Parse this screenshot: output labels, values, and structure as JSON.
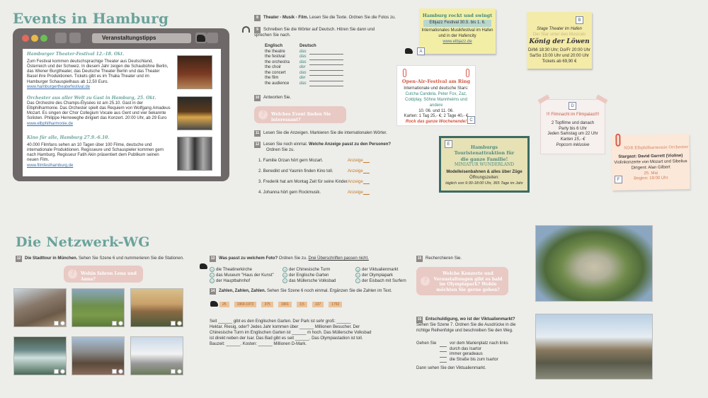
{
  "top": {
    "title": "Events in Hamburg",
    "window_title": "Veranstaltungstipps",
    "events": [
      {
        "heading": "Hamburger Theater-Festival 12.-18. Okt.",
        "text": "Zum Festival kommen deutschsprachige Theater aus Deutschland, Österreich und der Schweiz. In diesem Jahr zeigen die Schaubühne Berlin, das Wiener Burgtheater, das Deutsche Theater Berlin und das Theater Basel ihre Produktionen. Tickets gibt es im Thalia Theater und im Hamburger Schauspielhaus ab 12,50 Euro.",
        "link": "www.hamburgertheaterfestival.de"
      },
      {
        "heading": "Orchester aus aller Welt zu Gast in Hamburg, 25. Okt.",
        "text": "Das Orchestre des Champs-Élysées ist am 25.10. Gast in der Elbphilharmonie. Das Orchester spielt das Requiem von Wolfgang Amadeus Mozart. Es singen der Chor Collegium Vocale aus Gent und vier bekannte Solisten. Philippe Herreweghe dirigiert das Konzert. 20:00 Uhr, ab 29 Euro",
        "link": "www.elbphilharmonie.de"
      },
      {
        "heading": "Kino für alle, Hamburg 27.9.-6.10.",
        "text": "40.000 Filmfans sehen an 10 Tagen über 100 Filme, deutsche und internationale Produktionen. Regisseure und Schauspieler kommen gern nach Hamburg. Regisseur Fatih Akin präsentiert dem Publikum seinen neuen Film.",
        "link": "www.filmfesthamburg.de"
      }
    ],
    "t8": {
      "num": "8",
      "bold": "Theater - Musik - Film.",
      "text": " Lesen Sie die Texte. Ordnen Sie die Fotos zu."
    },
    "t9": {
      "num": "9",
      "text": "Schreiben Sie die Wörter auf Deutsch. Hören Sie dann und sprechen Sie nach.",
      "col1": "Englisch",
      "col2": "Deutsch",
      "rows": [
        {
          "en": "the theatre",
          "de": "das"
        },
        {
          "en": "the festival",
          "de": "das"
        },
        {
          "en": "the orchestra",
          "de": "das"
        },
        {
          "en": "the choir",
          "de": "der"
        },
        {
          "en": "the concert",
          "de": "das"
        },
        {
          "en": "the film",
          "de": "der"
        },
        {
          "en": "the audience",
          "de": "das"
        }
      ]
    },
    "t10": {
      "num": "10",
      "text": "Antworten Sie.",
      "bubble": "Welches Event finden Sie interessant?"
    },
    "t11": {
      "num": "11",
      "text": "Lesen Sie die Anzeigen. Markieren Sie die internationalen Wörter."
    },
    "t12": {
      "num": "12",
      "text": "Lesen Sie noch einmal. ",
      "bold": "Welche Anzeige passt zu den Personen?",
      "text2": "Ordnen Sie zu.",
      "items": [
        {
          "text": "1. Familie Orzan hört gern Mozart.",
          "label": "Anzeige"
        },
        {
          "text": "2. Benedikt und Yasmin finden Kino toll.",
          "label": "Anzeige"
        },
        {
          "text": "3. Frederik hat am Montag Zeit für seine Kinder.",
          "label": "Anzeige"
        },
        {
          "text": "4. Johanna hört gern Rockmusik.",
          "label": "Anzeige"
        }
      ]
    },
    "ads": {
      "A": {
        "letter": "A",
        "title": "Hamburg rockt und swingt",
        "sub": "Elbjazz Festival 30.5. bis 1. 6.",
        "text": "Internationales Musikfestival im Hafen und in der Hafencity",
        "link": "www.elbjazz.de"
      },
      "B": {
        "letter": "B",
        "l1": "Stage Theater im Hafen",
        "l2": "Der Star unter den Musicals",
        "title": "König der Löwen",
        "l3": "Di/Mi 18:30 Uhr; Do/Fr 20:00 Uhr",
        "l4": "Sa/So 15:00 Uhr und 20:00 Uhr",
        "l5": "Tickets ab 69,90 €"
      },
      "C": {
        "letter": "C",
        "title": "Open-Air-Festival am Ring",
        "l1": "Internationale und deutsche Stars:",
        "l2": "Culcha Candela, Peter Fox, Zaz, Coldplay, Söhne Mannheims und andere",
        "l3": "10. 06. und 11. 06.",
        "l4": "Karten: 1 Tag 25,- €; 2 Tage 40,- €",
        "l5": "Rock das ganze Wochenende!"
      },
      "D": {
        "letter": "D",
        "title": "!!! Filmnacht im Filmpalast!!!",
        "l1": "2 Topfilme und danach",
        "l2": "Party bis 6 Uhr",
        "l3": "Jeden Samstag um 22 Uhr",
        "l4": "Karten 15,- €",
        "l5": "Popcorn inklusive"
      },
      "E": {
        "letter": "E",
        "title": "Hamburgs Touristenattraktion für die ganze Familie!",
        "sub": "MINIATUR WUNDERLAND",
        "l1": "Modelleisenbahnen & alles über Züge",
        "l2": "Öffnungszeiten:",
        "l3": "täglich von 9:30-18:00 Uhr, 365 Tage im Jahr"
      },
      "F": {
        "letter": "F",
        "title": "NDR Elbphilharmonie Orchester",
        "l1": "Stargast: David Garrett (Violine)",
        "l2": "Violinkonzerte von Mozart und Sibelius",
        "l3": "Dirigent: Alan Gilbert",
        "l4": "25. Mai",
        "l5": "Beginn: 19:00 Uhr"
      }
    }
  },
  "bottom": {
    "title": "Die Netzwerk-WG",
    "t12": {
      "num": "12",
      "bold": "Die Stadttour in München.",
      "text": " Sehen Sie Szene 6 und nummerieren Sie die Stationen.",
      "bubble": "Wohin fahren Lena und Anna?"
    },
    "t13": {
      "num": "13",
      "bold": "Was passt zu welchem Foto?",
      "text": " Ordnen Sie zu. ",
      "under": "Drei Überschriften passen nicht.",
      "items": [
        {
          "letter": "a",
          "text": "die Theatinerkirche"
        },
        {
          "letter": "b",
          "text": "das Museum \"Haus der Kunst\""
        },
        {
          "letter": "c",
          "text": "der Hauptbahnhof"
        },
        {
          "letter": "d",
          "text": "der Chinesische Turm"
        },
        {
          "letter": "e",
          "text": "der Englische Garten"
        },
        {
          "letter": "f",
          "text": "das Müllersche Volksbad"
        },
        {
          "letter": "g",
          "text": "der Viktualienmarkt"
        },
        {
          "letter": "h",
          "text": "der Olympiapark"
        },
        {
          "letter": "i",
          "text": "der Eisbach mit Surfern"
        }
      ]
    },
    "t14": {
      "num": "14",
      "bold": "Zahlen, Zahlen, Zahlen.",
      "text": " Sehen Sie Szene 6 noch einmal. Ergänzen Sie die Zahlen im Text.",
      "years": [
        "25",
        "1969-1972",
        "375",
        "1901",
        "3,5",
        "137",
        "1792"
      ],
      "l1": "Seit ______ gibt es den Englischen Garten. Der Park ist sehr groß: ______",
      "l2": "Hektar. Riesig, oder? Jedes Jahr kommen über ______ Millionen Besucher. Der",
      "l3": "Chinesische Turm im Englischen Garten ist ______ m hoch. Das Müllersche Volksbad",
      "l4": "ist direkt neben der Isar. Das Bad gibt es seit ______. Das Olympiastadion ist toll.",
      "l5": "Bauzeit: ______. Kosten: ______ Millionen D-Mark."
    },
    "t15": {
      "num": "15",
      "text": "Recherchieren Sie.",
      "bubble": "Welche Konzerte und Veranstaltungen gibt es bald im Olympiapark? Wohin möchten Sie gerne gehen?"
    },
    "t16": {
      "num": "16",
      "bold": "Entschuldigung, wo ist der Viktualienmarkt?",
      "text": " Sehen Sie Szene 7. Ordnen Sie die Ausdrücke in die richtige Reihenfolge und beschreiben Sie den Weg.",
      "gehen": "Gehen Sie",
      "steps": [
        "vor dem Marienplatz nach links",
        "durch das Isartor",
        "immer geradeaus",
        "die Straße bis zum Isartor"
      ],
      "end": "Dann sehen Sie den Viktualienmarkt."
    }
  }
}
